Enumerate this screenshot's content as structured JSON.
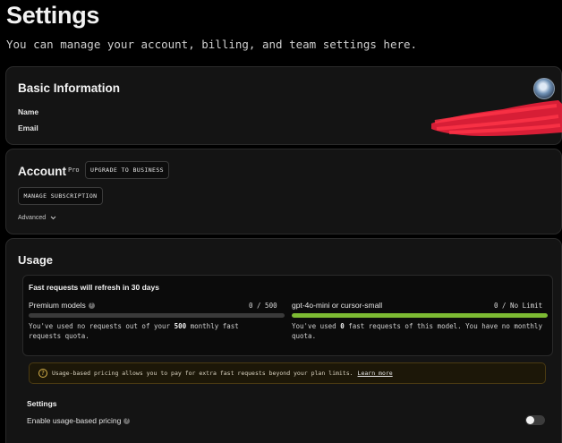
{
  "header": {
    "title": "Settings",
    "subtitle": "You can manage your account, billing, and team settings here."
  },
  "basic_info": {
    "title": "Basic Information",
    "name_label": "Name",
    "email_label": "Email"
  },
  "account": {
    "title": "Account",
    "plan_badge": "Pro",
    "upgrade_button": "UPGRADE TO BUSINESS",
    "manage_button": "MANAGE SUBSCRIPTION",
    "advanced_label": "Advanced"
  },
  "usage": {
    "title": "Usage",
    "refresh_note": "Fast requests will refresh in 30 days",
    "premium": {
      "name": "Premium models",
      "count": "0 / 500",
      "used_fraction": 0,
      "desc_pre": "You've used no requests out of your ",
      "desc_bold": "500",
      "desc_post": " monthly fast requests quota."
    },
    "mini": {
      "name": "gpt-4o-mini or cursor-small",
      "count": "0 / No Limit",
      "used_fraction": 1,
      "desc_pre": "You've used ",
      "desc_bold": "0",
      "desc_post": " fast requests of this model. You have no monthly quota."
    },
    "banner_text": "Usage-based pricing allows you to pay for extra fast requests beyond your plan limits.",
    "banner_link": "Learn more",
    "settings_label": "Settings",
    "usage_pricing_label": "Enable usage-based pricing",
    "usage_pricing_enabled": false
  },
  "icons": {
    "info": "info-circle-icon",
    "help": "question-mark-icon",
    "chevron": "chevron-down-icon"
  },
  "colors": {
    "background": "#000000",
    "card": "#141414",
    "progress_green": "#7dbb33",
    "banner_bg": "#1c1708",
    "redaction": "#e8203a"
  }
}
